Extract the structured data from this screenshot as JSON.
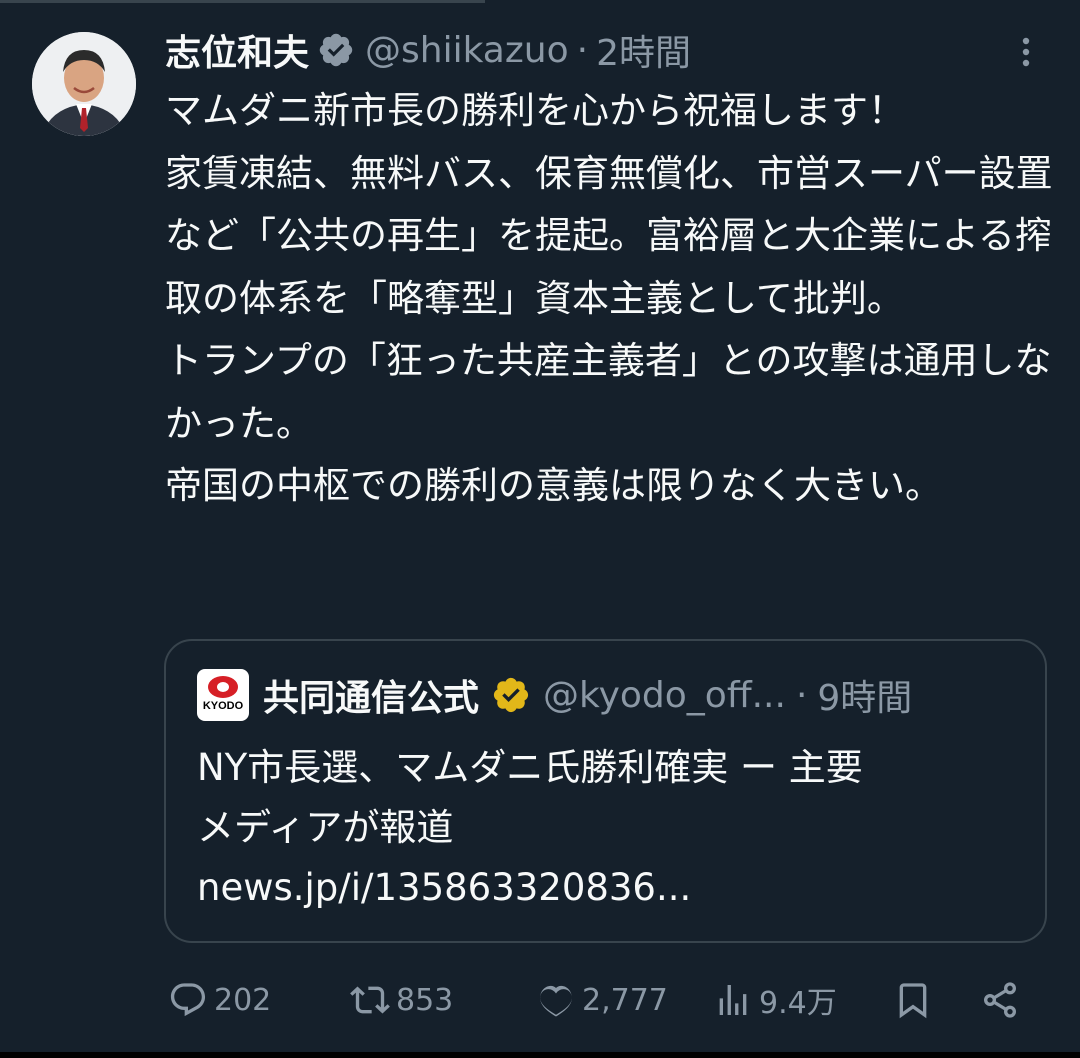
{
  "post": {
    "author_name": "志位和夫",
    "handle": "@shiikazuo",
    "separator": "·",
    "time": "2時間",
    "text": "マムダニ新市長の勝利を心から祝福します！\n家賃凍結、無料バス、保育無償化、市営スーパー設置など「公共の再生」を提起。富裕層と大企業による搾取の体系を「略奪型」資本主義として批判。\nトランプの「狂った共産主義者」との攻撃は通用しなかった。\n帝国の中枢での勝利の意義は限りなく大きい。",
    "verified_badge_color": "#8b98a5"
  },
  "quoted": {
    "logo_text": "KYODO",
    "author_name": "共同通信公式",
    "handle": "@kyodo_off...",
    "separator": "·",
    "time": "9時間",
    "text": "NY市長選、マムダニ氏勝利確実 ー 主要\nメディアが報道\nnews.jp/i/135863320836...",
    "verified_badge_color": "#e2b719"
  },
  "actions": {
    "replies": "202",
    "reposts": "853",
    "likes": "2,777",
    "views": "9.4万"
  },
  "icons": {
    "more": "more-vertical-icon",
    "reply": "reply-icon",
    "repost": "repost-icon",
    "like": "heart-icon",
    "views": "views-chart-icon",
    "bookmark": "bookmark-icon",
    "share": "share-icon"
  }
}
